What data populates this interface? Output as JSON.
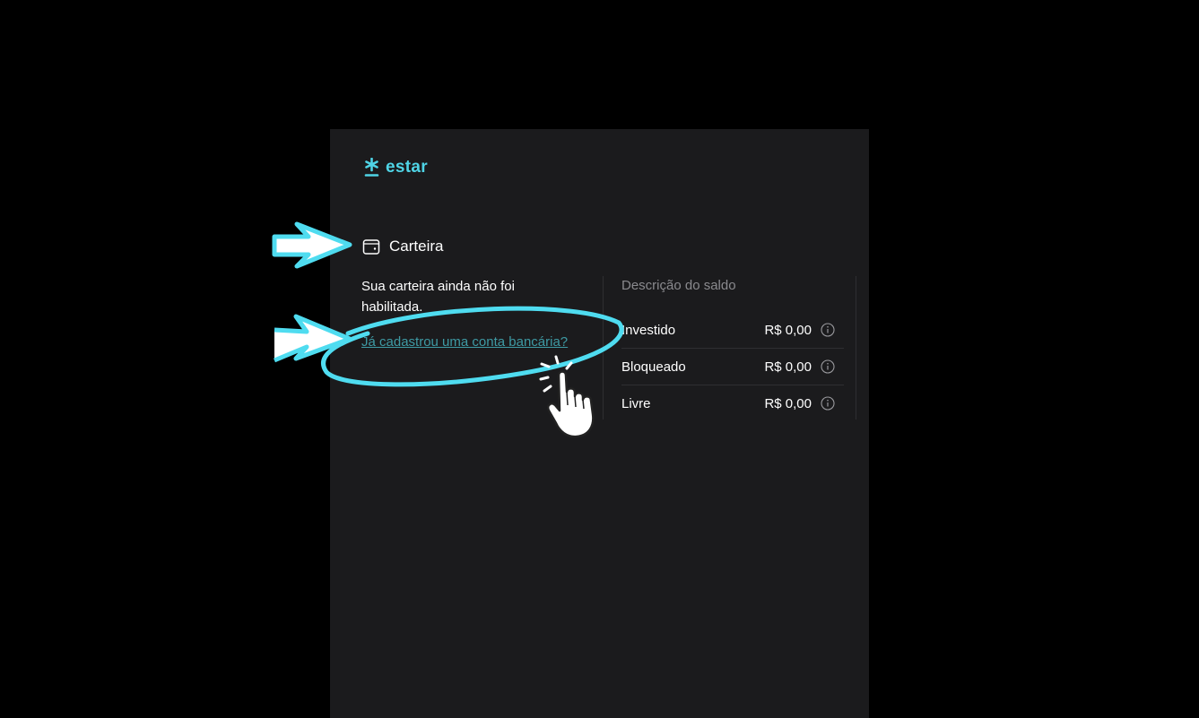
{
  "brand": {
    "name": "estar",
    "color": "#4fd4e6",
    "icon": "star-icon"
  },
  "wallet": {
    "title": "Carteira",
    "icon": "wallet-icon",
    "status_text": "Sua carteira ainda não foi habilitada.",
    "bank_link": "Já cadastrou uma conta bancária?"
  },
  "balance": {
    "title": "Descrição do saldo",
    "rows": [
      {
        "label": "Investido",
        "value": "R$ 0,00",
        "icon": "info-icon"
      },
      {
        "label": "Bloqueado",
        "value": "R$ 0,00",
        "icon": "info-icon"
      },
      {
        "label": "Livre",
        "value": "R$ 0,00",
        "icon": "info-icon"
      }
    ]
  },
  "annotations": {
    "highlight_color": "#4fdcf0",
    "items": [
      "arrow-icon",
      "arrow-icon",
      "hand-pointer-icon"
    ]
  }
}
